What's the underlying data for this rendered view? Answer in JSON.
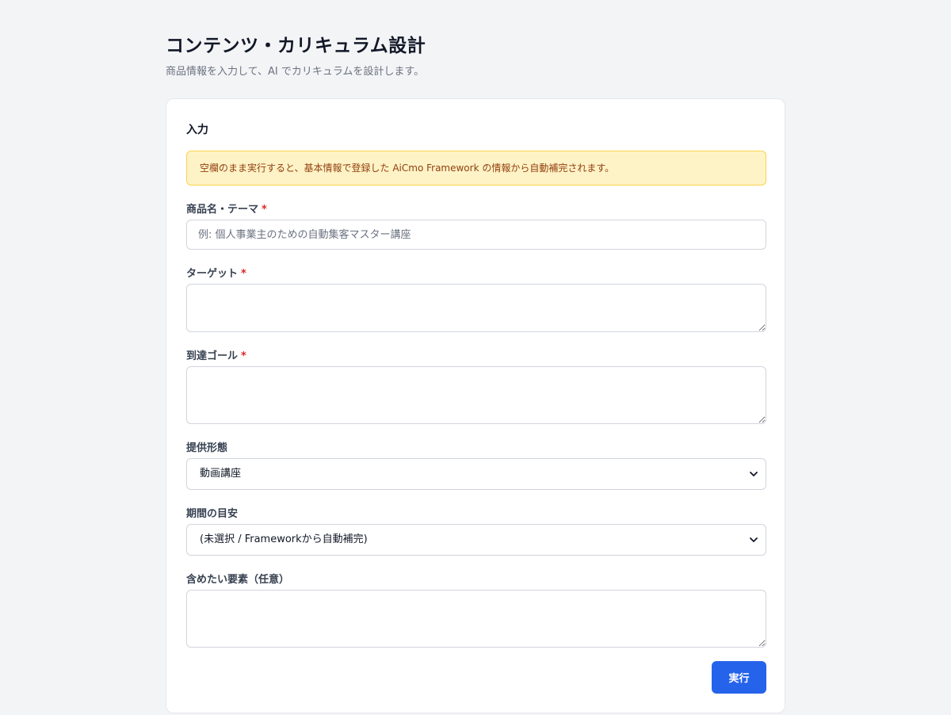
{
  "header": {
    "title": "コンテンツ・カリキュラム設計",
    "subtitle": "商品情報を入力して、AI でカリキュラムを設計します。"
  },
  "form": {
    "section_title": "入力",
    "notice": "空欄のまま実行すると、基本情報で登録した AiCmo Framework の情報から自動補完されます。",
    "required_mark": "*",
    "product": {
      "label": "商品名・テーマ",
      "value": "",
      "placeholder": "例: 個人事業主のための自動集客マスター講座"
    },
    "target": {
      "label": "ターゲット",
      "value": ""
    },
    "goal": {
      "label": "到達ゴール",
      "value": ""
    },
    "delivery": {
      "label": "提供形態",
      "selected": "動画講座"
    },
    "period": {
      "label": "期間の目安",
      "selected": "(未選択 / Frameworkから自動補完)"
    },
    "elements": {
      "label": "含めたい要素（任意）",
      "value": ""
    },
    "submit_label": "実行"
  },
  "colors": {
    "accent": "#2563eb",
    "required": "#dc2626",
    "notice_bg": "#fef3c7",
    "notice_text": "#92400e"
  },
  "icons": {
    "select_arrow": "chevron-down-icon"
  }
}
